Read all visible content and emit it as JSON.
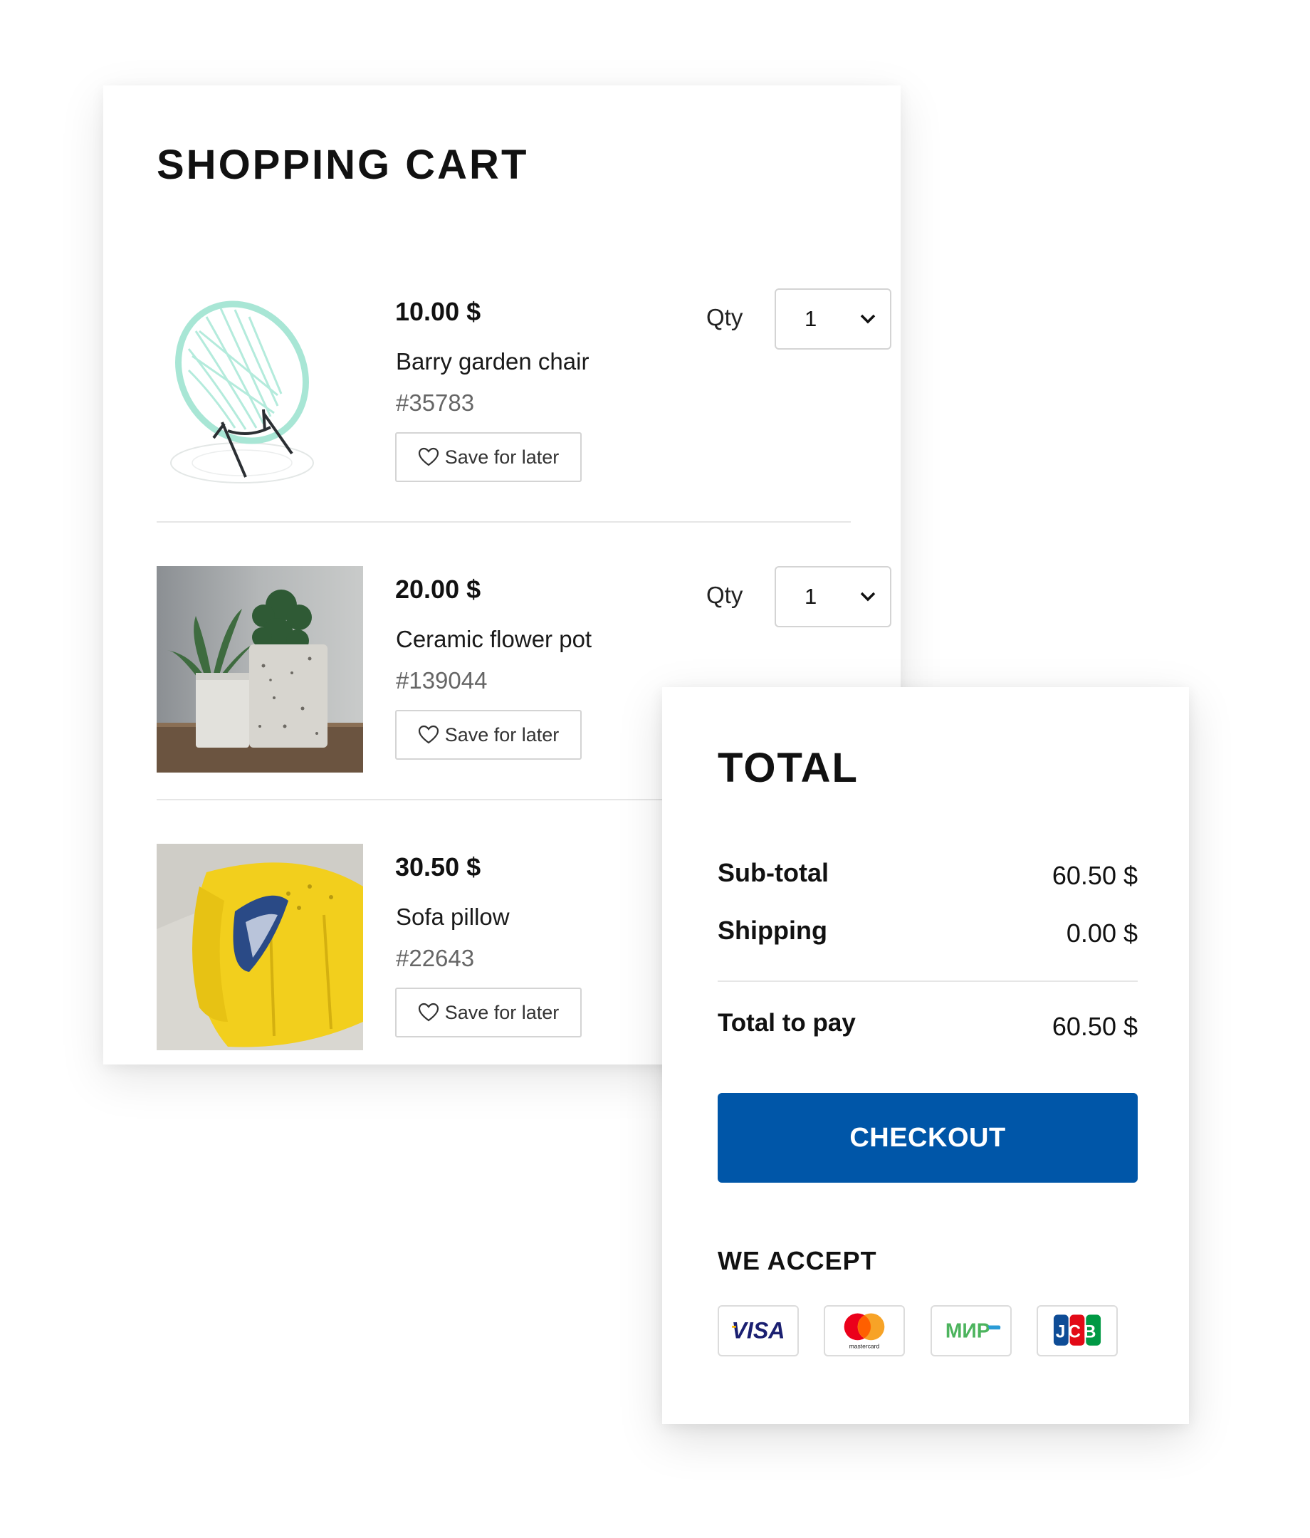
{
  "cart": {
    "title": "SHOPPING CART",
    "qty_label": "Qty",
    "save_label": "Save for later",
    "items": [
      {
        "price": "10.00 $",
        "name": "Barry garden chair",
        "sku": "#35783",
        "qty": "1"
      },
      {
        "price": "20.00 $",
        "name": "Ceramic flower pot",
        "sku": "#139044",
        "qty": "1"
      },
      {
        "price": "30.50 $",
        "name": "Sofa pillow",
        "sku": "#22643"
      }
    ]
  },
  "total": {
    "title": "TOTAL",
    "subtotal_label": "Sub-total",
    "subtotal_value": "60.50 $",
    "shipping_label": "Shipping",
    "shipping_value": "0.00 $",
    "total_label": "Total to pay",
    "total_value": "60.50 $",
    "checkout_label": "CHECKOUT",
    "accept_title": "WE ACCEPT",
    "payment_methods": [
      {
        "icon": "visa-icon",
        "text": "VISA"
      },
      {
        "icon": "mastercard-icon",
        "text": "mastercard"
      },
      {
        "icon": "mir-icon",
        "text": "МИР"
      },
      {
        "icon": "jcb-icon",
        "text": "JCB"
      }
    ]
  },
  "colors": {
    "checkout": "#0056a8",
    "visa": "#1a1f71",
    "mastercard_red": "#eb001b",
    "mastercard_orange": "#f79e1b",
    "mir": "#4db45e"
  }
}
